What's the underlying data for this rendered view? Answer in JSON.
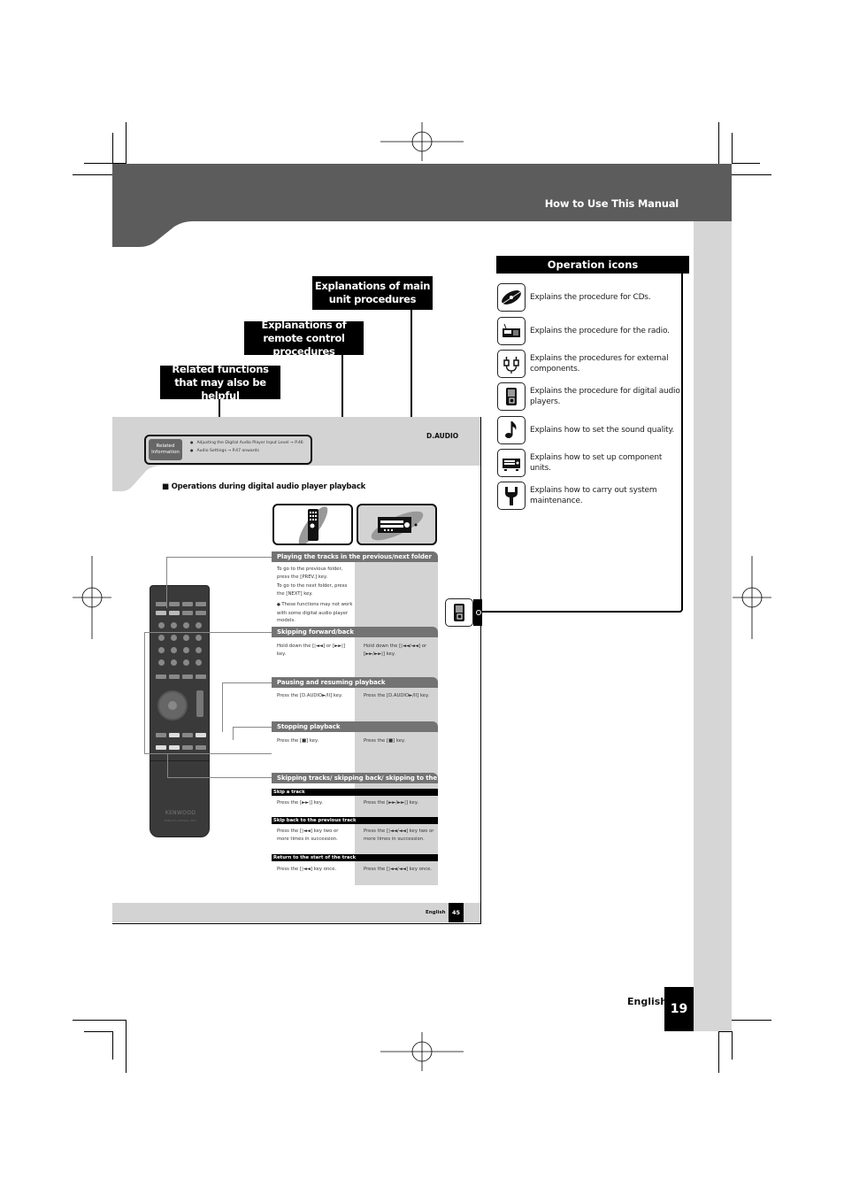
{
  "header": {
    "title": "How to Use This Manual"
  },
  "callouts": {
    "main_unit": "Explanations of main unit procedures",
    "remote": "Explanations of remote control procedures",
    "related": "Related functions that may also be helpful"
  },
  "operation_icons": {
    "title": "Operation icons",
    "items": [
      {
        "icon": "cd-icon",
        "text": "Explains the procedure for CDs."
      },
      {
        "icon": "radio-icon",
        "text": "Explains the procedure for the radio."
      },
      {
        "icon": "external-components-icon",
        "text": "Explains the procedures for external components."
      },
      {
        "icon": "digital-audio-player-icon",
        "text": "Explains the procedure for digital audio players."
      },
      {
        "icon": "music-note-icon",
        "text": "Explains how to set the sound quality."
      },
      {
        "icon": "component-unit-icon",
        "text": "Explains how to set up component units."
      },
      {
        "icon": "wrench-icon",
        "text": "Explains how to carry out system maintenance."
      }
    ]
  },
  "sample_page": {
    "related_badge": "Related Information",
    "related_items": [
      "Adjusting the Digital Audio Player Input Level → P.46",
      "Audio Settings → P.47 onwards"
    ],
    "source_label": "D.AUDIO",
    "section_title": "Operations during digital audio player playback",
    "procedures": [
      {
        "title": "Playing the tracks in the previous/next folder",
        "remote_lines": [
          "To go to the previous folder, press the [PREV.] key.",
          "To go to the next folder, press the [NEXT] key.",
          "These functions may not work with some digital audio player models."
        ],
        "unit_text": ""
      },
      {
        "title": "Skipping forward/back",
        "remote_text": "Hold down the [|◄◄] or [►►|] key.",
        "unit_text": "Hold down the [|◄◄/◄◄] or [►►/►►|] key."
      },
      {
        "title": "Pausing and resuming playback",
        "remote_text": "Press the [D.AUDIO►/II] key.",
        "unit_text": "Press the [D.AUDIO►/II] key."
      },
      {
        "title": "Stopping playback",
        "remote_text": "Press the [■] key.",
        "unit_text": "Press the [■] key."
      },
      {
        "title": "Skipping tracks/ skipping back/ skipping to the start",
        "subsections": [
          {
            "title": "Skip a track",
            "remote_text": "Press the [►►|] key.",
            "unit_text": "Press the [►►/►►|] key."
          },
          {
            "title": "Skip back to the previous track",
            "remote_text": "Press the [|◄◄] key two or more times in succession.",
            "unit_text": "Press the [|◄◄/◄◄] key two or more times in succession."
          },
          {
            "title": "Return to the start of the track",
            "remote_text": "Press the [|◄◄] key once.",
            "unit_text": "Press the [|◄◄/◄◄] key once."
          }
        ]
      }
    ],
    "remote_brand": "KENWOOD",
    "remote_model": "REMOTE CONTROL UNIT",
    "footer_lang": "English",
    "footer_page": "45"
  },
  "footer": {
    "lang": "English",
    "page": "19"
  },
  "colors": {
    "header_band": "#5c5c5c",
    "side_column": "#d6d6d6",
    "sample_gray": "#d3d3d3",
    "proc_bar": "#737373",
    "label_bg": "#000000"
  }
}
